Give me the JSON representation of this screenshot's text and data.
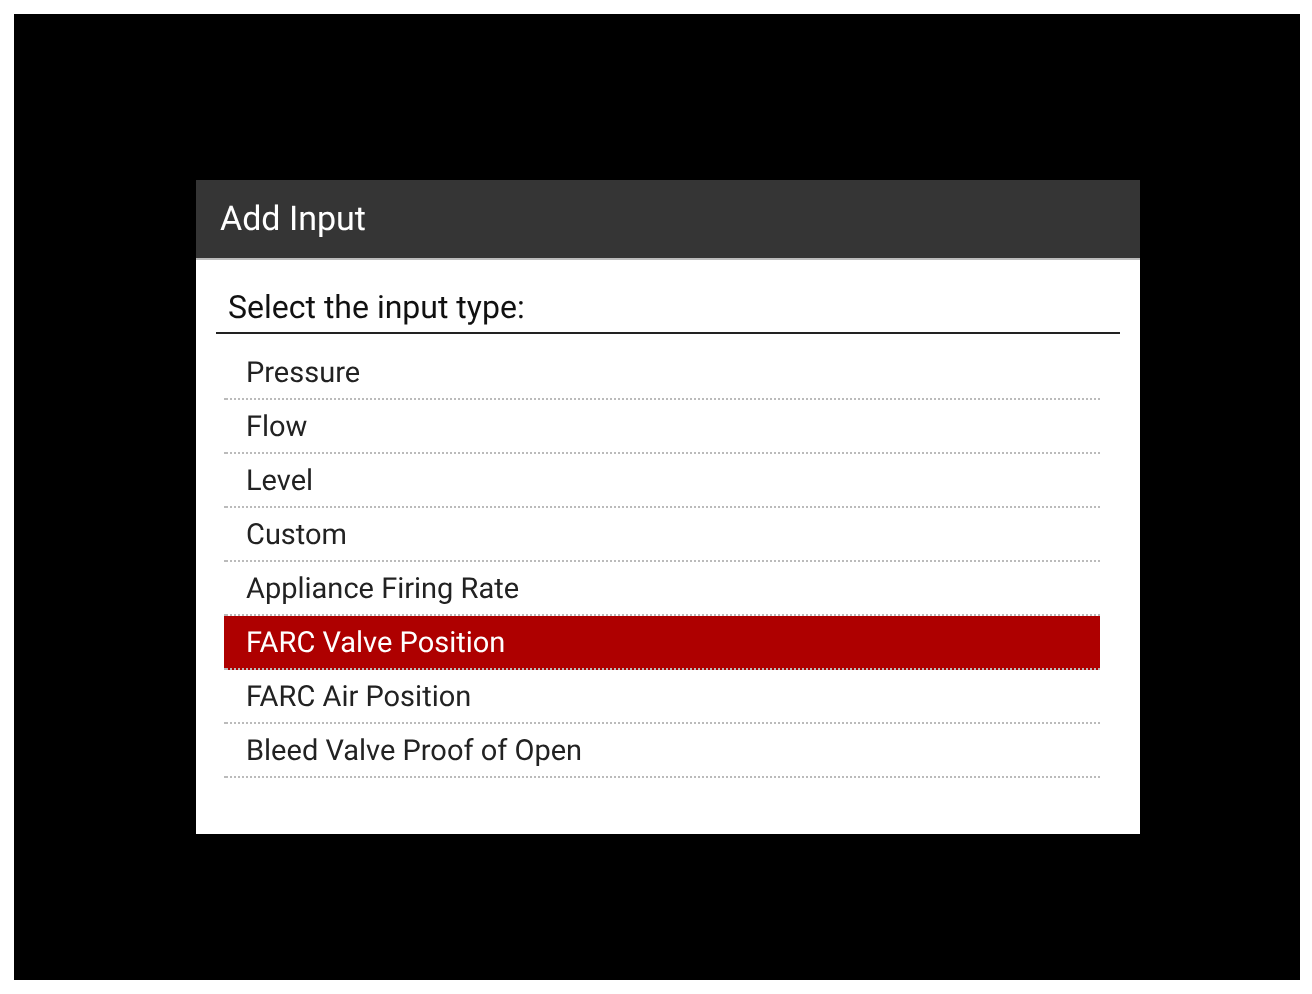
{
  "dialog": {
    "title": "Add Input",
    "prompt": "Select the input type:",
    "items": [
      {
        "label": "Pressure",
        "selected": false
      },
      {
        "label": "Flow",
        "selected": false
      },
      {
        "label": "Level",
        "selected": false
      },
      {
        "label": "Custom",
        "selected": false
      },
      {
        "label": "Appliance Firing Rate",
        "selected": false
      },
      {
        "label": "FARC Valve Position",
        "selected": true
      },
      {
        "label": "FARC Air Position",
        "selected": false
      },
      {
        "label": "Bleed Valve Proof of Open",
        "selected": false
      }
    ]
  }
}
